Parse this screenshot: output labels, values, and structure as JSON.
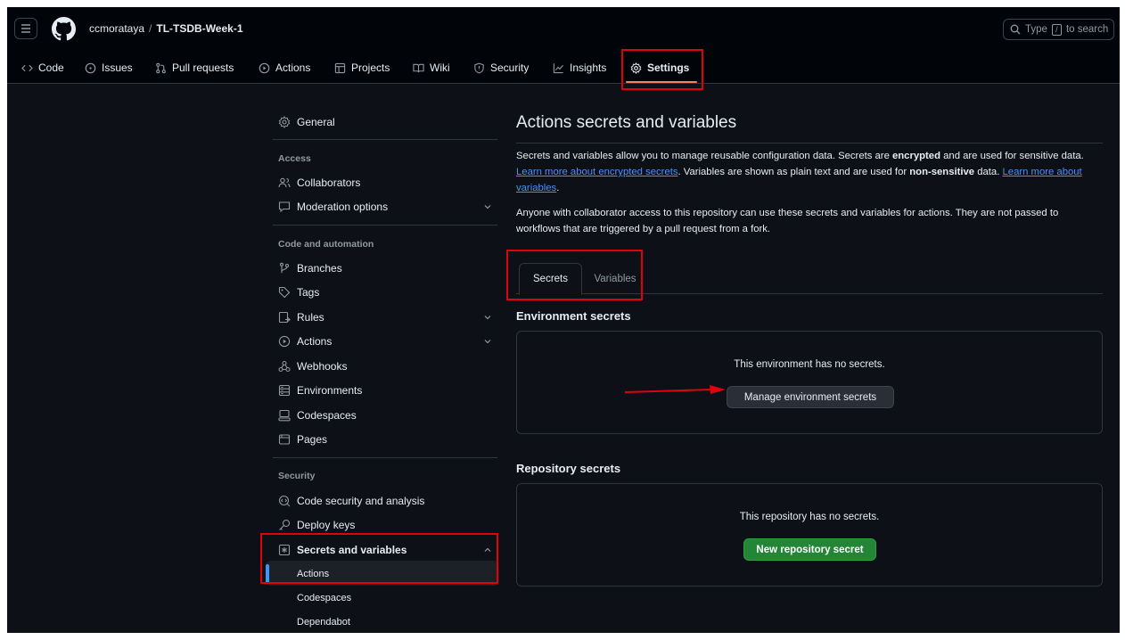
{
  "header": {
    "owner": "ccmorataya",
    "separator": "/",
    "repo": "TL-TSDB-Week-1",
    "search_placeholder": "Type",
    "search_key": "/",
    "search_suffix": "to search"
  },
  "repo_nav": {
    "tabs": [
      {
        "label": "Code",
        "icon": "code-icon"
      },
      {
        "label": "Issues",
        "icon": "issue-icon"
      },
      {
        "label": "Pull requests",
        "icon": "pull-request-icon"
      },
      {
        "label": "Actions",
        "icon": "play-icon"
      },
      {
        "label": "Projects",
        "icon": "table-icon"
      },
      {
        "label": "Wiki",
        "icon": "book-icon"
      },
      {
        "label": "Security",
        "icon": "shield-icon"
      },
      {
        "label": "Insights",
        "icon": "graph-icon"
      },
      {
        "label": "Settings",
        "icon": "gear-icon",
        "active": true
      }
    ],
    "active_underline_color": "#f78166"
  },
  "sidebar": {
    "general": "General",
    "access_heading": "Access",
    "access": [
      "Collaborators",
      "Moderation options"
    ],
    "code_heading": "Code and automation",
    "code": [
      "Branches",
      "Tags",
      "Rules",
      "Actions",
      "Webhooks",
      "Environments",
      "Codespaces",
      "Pages"
    ],
    "security_heading": "Security",
    "security": [
      "Code security and analysis",
      "Deploy keys",
      "Secrets and variables"
    ],
    "secrets_sub": [
      "Actions",
      "Codespaces",
      "Dependabot"
    ],
    "active_item": "Actions"
  },
  "main": {
    "title": "Actions secrets and variables",
    "intro": {
      "t1": "Secrets and variables allow you to manage reusable configuration data. Secrets are ",
      "b1": "encrypted",
      "t2": " and are used for sensitive data. ",
      "link1": "Learn more about encrypted secrets",
      "t3": ". Variables are shown as plain text and are used for ",
      "b2": "non-sensitive",
      "t4": " data. ",
      "link2": "Learn more about variables",
      "t5": "."
    },
    "notice": "Anyone with collaborator access to this repository can use these secrets and variables for actions. They are not passed to workflows that are triggered by a pull request from a fork.",
    "tabs": [
      "Secrets",
      "Variables"
    ],
    "env_secrets_heading": "Environment secrets",
    "env_empty": "This environment has no secrets.",
    "env_button": "Manage environment secrets",
    "repo_secrets_heading": "Repository secrets",
    "repo_empty": "This repository has no secrets.",
    "repo_button": "New repository secret"
  },
  "colors": {
    "background": "#0d1117",
    "header": "#010409",
    "link": "#4493f8",
    "primary_button": "#238636",
    "annotation": "#e3000b"
  }
}
